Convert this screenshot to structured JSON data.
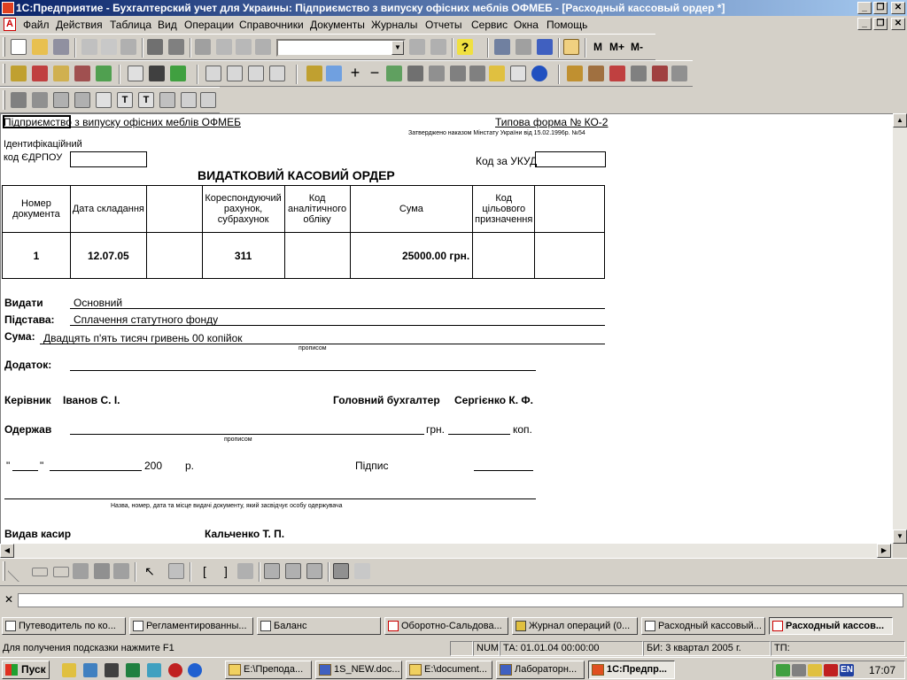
{
  "window": {
    "title": "1С:Предприятие - Бухгалтерский учет для Украины: Підприємство з випуску офісних меблів ОФМЕБ - [Расходный кассовый ордер *]",
    "controls": [
      "_",
      "❐",
      "✕"
    ]
  },
  "menubar": {
    "items": [
      "Файл",
      "Действия",
      "Таблица",
      "Вид",
      "Операции",
      "Справочники",
      "Документы",
      "Журналы",
      "Отчеты",
      "Сервис",
      "Окна",
      "Помощь"
    ],
    "doc_controls": [
      "_",
      "❐",
      "✕"
    ]
  },
  "toolbar": {
    "memory_buttons": [
      "M",
      "M+",
      "M-"
    ],
    "combo_value": ""
  },
  "document": {
    "company": "Підприємство з випуску офісних меблів ОФМЕБ",
    "form_name": "Типова форма № КО-2",
    "approved": "Затверджено наказом Мінстату України від 15.02.1996р. №54",
    "ident_label_1": "Ідентифікаційний",
    "ident_label_2": "код ЄДРПОУ",
    "ukud_label": "Код за УКУД",
    "title": "ВИДАТКОВИЙ КАСОВИЙ ОРДЕР",
    "table": {
      "headers": [
        "Номер документа",
        "Дата складання",
        "",
        "Кореспондуючий рахунок, субрахунок",
        "Код аналітичного обліку",
        "Сума",
        "Код цільового призначення",
        ""
      ],
      "row": [
        "1",
        "12.07.05",
        "",
        "311",
        "",
        "25000.00 грн.",
        "",
        ""
      ]
    },
    "issue_label": "Видати",
    "issue_value": "Основний",
    "basis_label": "Підстава:",
    "basis_value": "Сплачення статутного фонду",
    "sum_label": "Сума:",
    "sum_value": "Двадцять п'ять тисяч гривень 00 копійок",
    "in_words": "прописом",
    "attachment_label": "Додаток:",
    "head_label": "Керівник",
    "head_name": "Іванов С. І.",
    "chief_label": "Головний  бухгалтер",
    "chief_name": "Сергієнко К. Ф.",
    "received_label": "Одержав",
    "received_hrn": "грн.",
    "received_kop": "коп.",
    "received_in_words": "прописом",
    "date_quote_open": "\"",
    "date_quote_close": "\"",
    "date_year": "200",
    "date_r": "р.",
    "signature_label": "Підпис",
    "id_doc_caption": "Назва, номер, дата та місце видачі документу, який засвідчує особу одержувача",
    "cashier_label": "Видав касир",
    "cashier_name": "Кальченко Т. П."
  },
  "message_panel": {
    "close": "✕",
    "text": ""
  },
  "window_bar": {
    "tabs": [
      "Путеводитель по ко...",
      "Регламентированны...",
      "Баланс",
      "Оборотно-Сальдова...",
      "Журнал операций (0...",
      "Расходный кассовый...",
      "Расходный кассов..."
    ],
    "active_index": 6
  },
  "statusbar": {
    "hint": "Для получения подсказки нажмите F1",
    "num": "NUM",
    "ta": "ТА: 01.01.04  00:00:00",
    "bi": "БИ: 3 квартал 2005 г.",
    "tp": "ТП:"
  },
  "taskbar": {
    "start": "Пуск",
    "tasks": [
      "E:\\Препода...",
      "1S_NEW.doc...",
      "E:\\document...",
      "Лабораторн...",
      "1С:Предпр..."
    ],
    "active_index": 4,
    "tray_lang": "EN",
    "clock": "17:07"
  }
}
